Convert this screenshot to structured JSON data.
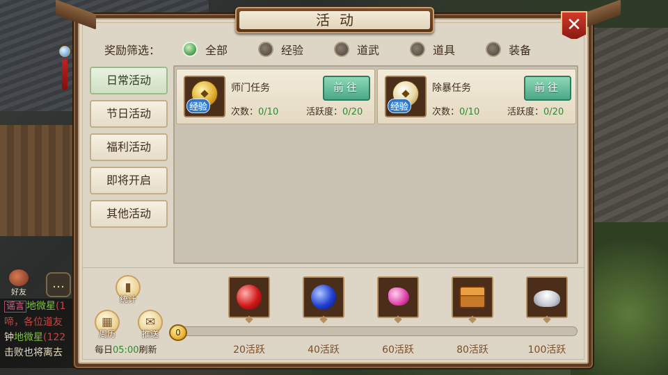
{
  "dialog": {
    "title": "活动",
    "close_icon": "✕"
  },
  "filter": {
    "label": "奖励筛选：",
    "options": [
      {
        "label": "全部",
        "selected": true
      },
      {
        "label": "经验",
        "selected": false
      },
      {
        "label": "道武",
        "selected": false
      },
      {
        "label": "道具",
        "selected": false
      },
      {
        "label": "装备",
        "selected": false
      }
    ]
  },
  "tabs": [
    {
      "label": "日常活动",
      "active": true
    },
    {
      "label": "节日活动",
      "active": false
    },
    {
      "label": "福利活动",
      "active": false
    },
    {
      "label": "即将开启",
      "active": false
    },
    {
      "label": "其他活动",
      "active": false
    }
  ],
  "activities": [
    {
      "name": "师门任务",
      "count_label": "次数：",
      "count": "0/10",
      "activity_label": "活跃度：",
      "activity": "0/20",
      "button": "前往",
      "icon_tag": "经验",
      "icon": "coin-icon"
    },
    {
      "name": "除暴任务",
      "count_label": "次数：",
      "count": "0/10",
      "activity_label": "活跃度：",
      "activity": "0/20",
      "button": "前往",
      "icon_tag": "经验",
      "icon": "yinyang-coin-icon"
    }
  ],
  "bottom": {
    "stats_button": "统计",
    "calendar_button": "周历",
    "push_button": "推送",
    "refresh_prefix": "每日",
    "refresh_time": "05:00",
    "refresh_suffix": "刷新",
    "current_activity": "0",
    "progress_fraction": 0.0
  },
  "rewards": [
    {
      "threshold": "20活跃",
      "icon": "red-orb-icon"
    },
    {
      "threshold": "40活跃",
      "icon": "blue-orb-icon"
    },
    {
      "threshold": "60活跃",
      "icon": "pink-gems-icon"
    },
    {
      "threshold": "80活跃",
      "icon": "treasure-chest-icon"
    },
    {
      "threshold": "100活跃",
      "icon": "silver-ingot-icon"
    }
  ],
  "hud": {
    "friend_label": "好友",
    "chat_lines": [
      {
        "channel": "谣言",
        "name": "地微星",
        "extra": "(1"
      },
      {
        "text": "啼，各位道友"
      },
      {
        "prefix": "钟",
        "name": "地微星",
        "extra": "(122"
      },
      {
        "text": "击败也将离去"
      }
    ]
  },
  "colors": {
    "frame": "#5a3a22",
    "panel": "#ddd6c6",
    "accent_green": "#2e8a2e",
    "go_button": "#4aa888",
    "close_red": "#d23a2a"
  }
}
